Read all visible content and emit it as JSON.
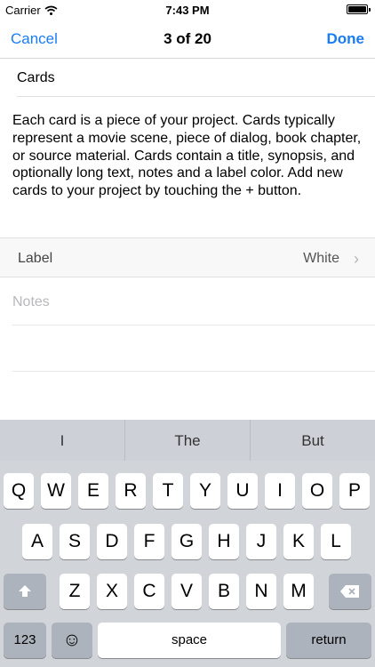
{
  "status": {
    "carrier": "Carrier",
    "time": "7:43 PM"
  },
  "nav": {
    "cancel": "Cancel",
    "title": "3 of 20",
    "done": "Done"
  },
  "card": {
    "title": "Cards",
    "synopsis": "Each card is a piece of your project. Cards typically represent a movie scene, piece of dialog, book chapter, or source material. Cards contain a title, synopsis, and optionally long text, notes and a label color. Add new cards to your project by touching the + button.",
    "label_caption": "Label",
    "label_value": "White",
    "notes_placeholder": "Notes"
  },
  "keyboard": {
    "suggestions": [
      "I",
      "The",
      "But"
    ],
    "row1": [
      "Q",
      "W",
      "E",
      "R",
      "T",
      "Y",
      "U",
      "I",
      "O",
      "P"
    ],
    "row2": [
      "A",
      "S",
      "D",
      "F",
      "G",
      "H",
      "J",
      "K",
      "L"
    ],
    "row3": [
      "Z",
      "X",
      "C",
      "V",
      "B",
      "N",
      "M"
    ],
    "numbers": "123",
    "space": "space",
    "return": "return"
  }
}
